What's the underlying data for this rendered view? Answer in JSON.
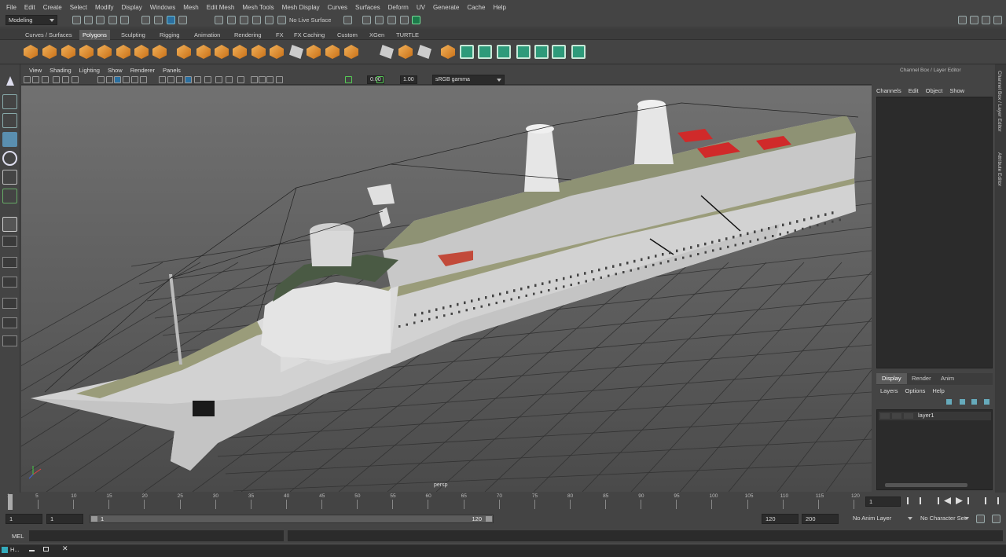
{
  "menubar": [
    "File",
    "Edit",
    "Create",
    "Select",
    "Modify",
    "Display",
    "Windows",
    "Mesh",
    "Edit Mesh",
    "Mesh Tools",
    "Mesh Display",
    "Curves",
    "Surfaces",
    "Deform",
    "UV",
    "Generate",
    "Cache",
    "Help"
  ],
  "status": {
    "mode": "Modeling",
    "live_surface": "No Live Surface"
  },
  "shelf_tabs": [
    "Curves / Surfaces",
    "Polygons",
    "Sculpting",
    "Rigging",
    "Animation",
    "Rendering",
    "FX",
    "FX Caching",
    "Custom",
    "XGen",
    "TURTLE"
  ],
  "shelf_active": "Polygons",
  "viewport": {
    "menu": [
      "View",
      "Shading",
      "Lighting",
      "Show",
      "Renderer",
      "Panels"
    ],
    "near_value": "0.00",
    "far_value": "1.00",
    "color_space": "sRGB gamma",
    "camera_label": "persp"
  },
  "channel_box": {
    "title": "Channel Box / Layer Editor",
    "menu": [
      "Channels",
      "Edit",
      "Object",
      "Show"
    ]
  },
  "layer_editor": {
    "tabs": [
      "Display",
      "Render",
      "Anim"
    ],
    "active_tab": "Display",
    "menu": [
      "Layers",
      "Options",
      "Help"
    ],
    "layers": [
      "layer1"
    ]
  },
  "side_tabs": [
    "Channel Box / Layer Editor",
    "Attribute Editor"
  ],
  "timeline": {
    "ticks": [
      "1",
      "5",
      "10",
      "15",
      "20",
      "25",
      "30",
      "35",
      "40",
      "45",
      "50",
      "55",
      "60",
      "65",
      "70",
      "75",
      "80",
      "85",
      "90",
      "95",
      "100",
      "105",
      "110",
      "115",
      "120"
    ],
    "current_frame": "1"
  },
  "range": {
    "start": "1",
    "playback_start": "1",
    "range_start": "1",
    "range_end": "120",
    "playback_end": "120",
    "end": "200",
    "anim_layer": "No Anim Layer",
    "char_set": "No Character Set"
  },
  "cmd": {
    "label": "MEL"
  },
  "taskbar": {
    "title": "H..."
  }
}
